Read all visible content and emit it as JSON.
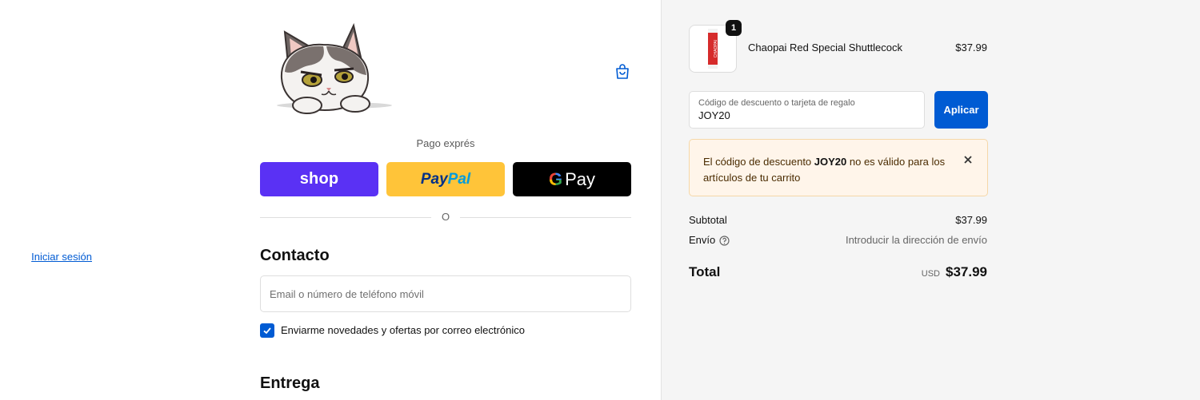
{
  "header": {
    "logo_icon": "cat-logo",
    "cart_icon": "shopping-bag-icon"
  },
  "express": {
    "label": "Pago exprés",
    "shop_label": "shop",
    "paypal_pay": "Pay",
    "paypal_pal": "Pal",
    "gpay_g": "G",
    "gpay_label": "Pay",
    "divider_text": "O"
  },
  "contact": {
    "title": "Contacto",
    "login_link": "Iniciar sesión",
    "email_placeholder": "Email o número de teléfono móvil",
    "email_value": "",
    "newsletter_label": "Enviarme novedades y ofertas por correo electrónico",
    "newsletter_checked": true
  },
  "delivery": {
    "title": "Entrega"
  },
  "summary": {
    "item": {
      "name": "Chaopai Red Special Shuttlecock",
      "price": "$37.99",
      "quantity": "1",
      "thumb_text": "CHAOPAI"
    },
    "discount": {
      "label": "Código de descuento o tarjeta de regalo",
      "value": "JOY20",
      "apply_label": "Aplicar"
    },
    "alert": {
      "prefix": "El código de descuento ",
      "code": "JOY20",
      "suffix": " no es válido para los artículos de tu carrito"
    },
    "subtotal_label": "Subtotal",
    "subtotal_value": "$37.99",
    "shipping_label": "Envío",
    "shipping_value": "Introducir la dirección de envío",
    "total_label": "Total",
    "total_currency": "USD",
    "total_value": "$37.99"
  },
  "colors": {
    "primary": "#005bd3",
    "shop_purple": "#5a31f4",
    "paypal_yellow": "#ffc439",
    "alert_bg": "#fff5ea"
  }
}
